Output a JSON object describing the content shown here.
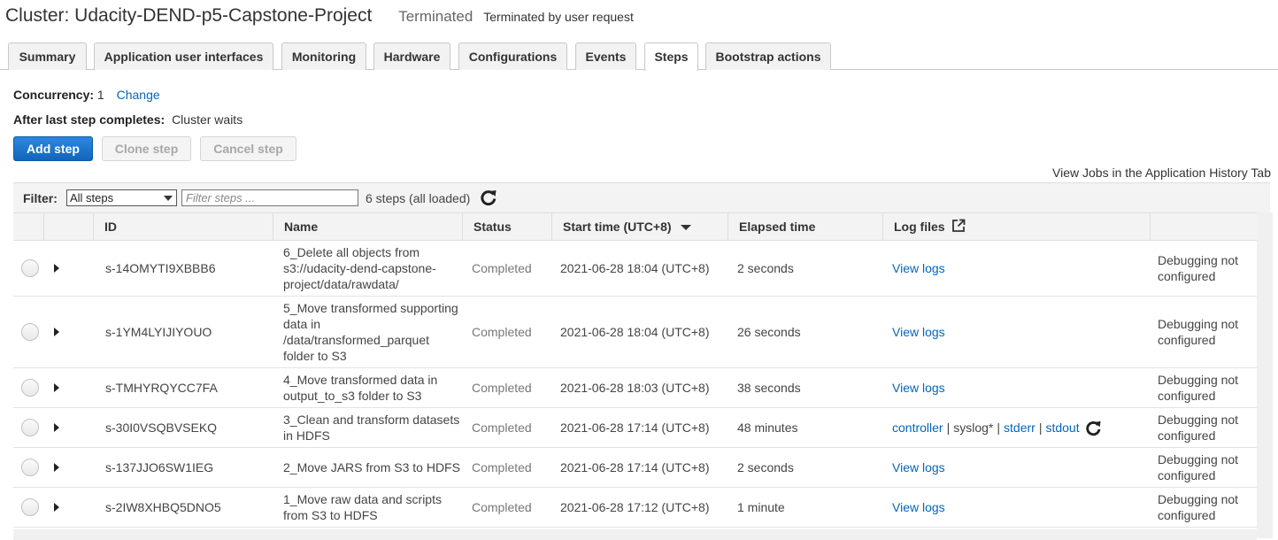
{
  "header": {
    "title": "Cluster: Udacity-DEND-p5-Capstone-Project",
    "state": "Terminated",
    "state_reason": "Terminated by user request"
  },
  "tabs": [
    {
      "label": "Summary"
    },
    {
      "label": "Application user interfaces"
    },
    {
      "label": "Monitoring"
    },
    {
      "label": "Hardware"
    },
    {
      "label": "Configurations"
    },
    {
      "label": "Events"
    },
    {
      "label": "Steps",
      "active": true
    },
    {
      "label": "Bootstrap actions"
    }
  ],
  "concurrency": {
    "label": "Concurrency:",
    "value": "1",
    "change_link": "Change",
    "after_label": "After last step completes:",
    "after_value": "Cluster waits"
  },
  "actions": {
    "add": "Add step",
    "clone": "Clone step",
    "cancel": "Cancel step"
  },
  "history_link": "View Jobs in the Application History Tab",
  "filter": {
    "label": "Filter:",
    "selected": "All steps",
    "placeholder": "Filter steps ...",
    "count": "6 steps (all loaded)",
    "refresh_icon": "refresh-icon"
  },
  "table": {
    "columns": {
      "id": "ID",
      "name": "Name",
      "status": "Status",
      "start": "Start time (UTC+8)",
      "elapsed": "Elapsed time",
      "logs": "Log files"
    },
    "rows": [
      {
        "id": "s-14OMYTI9XBBB6",
        "name": "6_Delete all objects from s3://udacity-dend-capstone-project/data/rawdata/",
        "status": "Completed",
        "start": "2021-06-28 18:04 (UTC+8)",
        "elapsed": "2 seconds",
        "logs": "View logs",
        "debug": "Debugging not configured"
      },
      {
        "id": "s-1YM4LYIJIYOUO",
        "name": "5_Move transformed supporting data in /data/transformed_parquet folder to S3",
        "status": "Completed",
        "start": "2021-06-28 18:04 (UTC+8)",
        "elapsed": "26 seconds",
        "logs": "View logs",
        "debug": "Debugging not configured"
      },
      {
        "id": "s-TMHYRQYCC7FA",
        "name": "4_Move transformed data in output_to_s3 folder to S3",
        "status": "Completed",
        "start": "2021-06-28 18:03 (UTC+8)",
        "elapsed": "38 seconds",
        "logs": "View logs",
        "debug": "Debugging not configured"
      },
      {
        "id": "s-30I0VSQBVSEKQ",
        "name": "3_Clean and transform datasets in HDFS",
        "status": "Completed",
        "start": "2021-06-28 17:14 (UTC+8)",
        "elapsed": "48 minutes",
        "log_parts": {
          "controller": "controller",
          "syslog": "syslog*",
          "stderr": "stderr",
          "stdout": "stdout",
          "separator": "|"
        },
        "debug": "Debugging not configured"
      },
      {
        "id": "s-137JJO6SW1IEG",
        "name": "2_Move JARS from S3 to HDFS",
        "status": "Completed",
        "start": "2021-06-28 17:14 (UTC+8)",
        "elapsed": "2 seconds",
        "logs": "View logs",
        "debug": "Debugging not configured"
      },
      {
        "id": "s-2IW8XHBQ5DNO5",
        "name": "1_Move raw data and scripts from S3 to HDFS",
        "status": "Completed",
        "start": "2021-06-28 17:12 (UTC+8)",
        "elapsed": "1 minute",
        "logs": "View logs",
        "debug": "Debugging not configured"
      }
    ]
  },
  "colors": {
    "link": "#0066c0",
    "primary_button": "#1166bb"
  }
}
